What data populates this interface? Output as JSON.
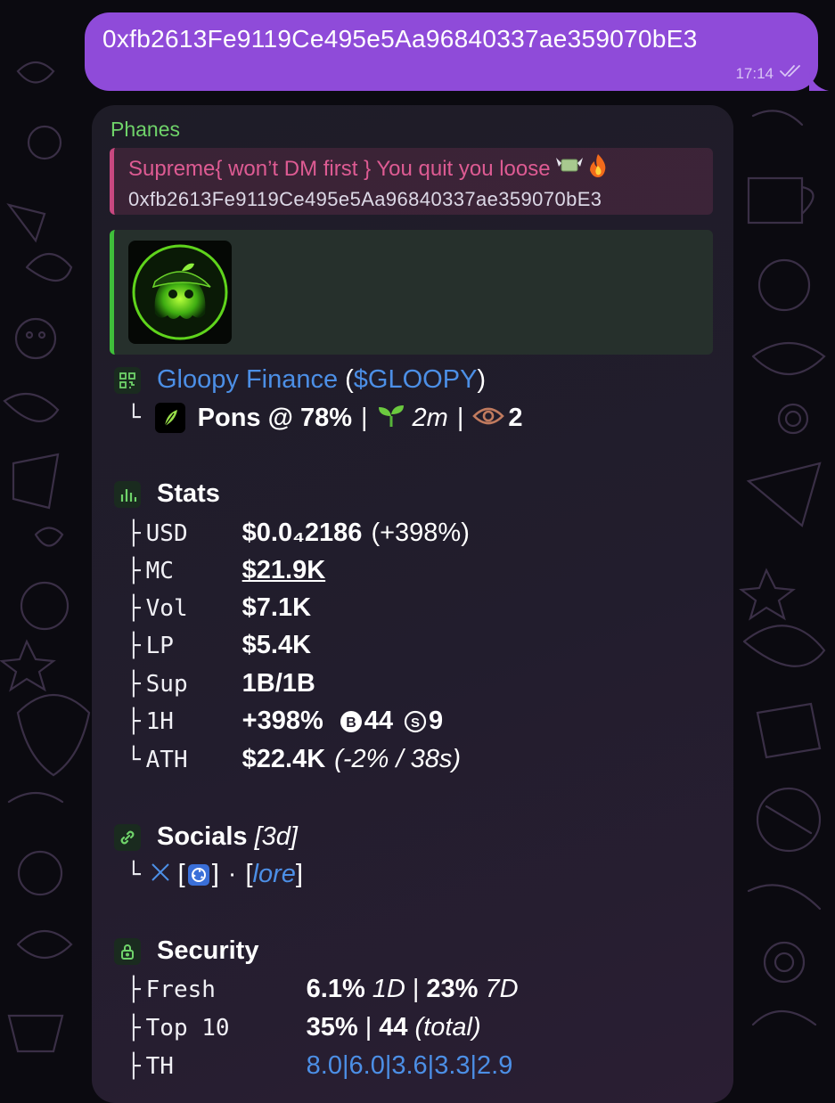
{
  "outgoing": {
    "text": "0xfb2613Fe9119Ce495e5Aa96840337ae359070bE3",
    "time": "17:14"
  },
  "incoming": {
    "sender": "Phanes",
    "reply": {
      "title": "Supreme{ won’t DM first } You quit you loose",
      "text": "0xfb2613Fe9119Ce495e5Aa96840337ae359070bE3"
    },
    "token": {
      "name": "Gloopy Finance",
      "ticker": "$GLOOPY",
      "open_paren": "(",
      "close_paren": ")",
      "sub_prefix": "└",
      "platform": "Pons @ 78%",
      "sep": "|",
      "age": "2m",
      "views": "2"
    },
    "stats": {
      "title": "Stats",
      "rows": {
        "usd": {
          "tree": "├",
          "label": "USD",
          "value": "$0.0₄2186",
          "extra": "(+398%)"
        },
        "mc": {
          "tree": "├",
          "label": "MC",
          "value": "$21.9K"
        },
        "vol": {
          "tree": "├",
          "label": "Vol",
          "value": "$7.1K"
        },
        "lp": {
          "tree": "├",
          "label": "LP",
          "value": "$5.4K"
        },
        "sup": {
          "tree": "├",
          "label": "Sup",
          "value": "1B/1B"
        },
        "h1": {
          "tree": "├",
          "label": "1H",
          "value": "+398%",
          "buys": "44",
          "sells": "9"
        },
        "ath": {
          "tree": "└",
          "label": "ATH",
          "value": "$22.4K",
          "extra": "(-2% / 38s)"
        }
      }
    },
    "socials": {
      "title": "Socials",
      "age": "[3d]",
      "tree": "└",
      "x_open": "[",
      "x_close": "]",
      "dot": "·",
      "lore_open": "[",
      "lore": "lore",
      "lore_close": "]"
    },
    "security": {
      "title": "Security",
      "fresh": {
        "tree": "├",
        "label": "Fresh",
        "v1": "6.1%",
        "p1": "1D",
        "sep": "|",
        "v2": "23%",
        "p2": "7D"
      },
      "top10": {
        "tree": "├",
        "label": "Top 10",
        "v1": "35%",
        "sep": "|",
        "v2": "44",
        "p2": "(total)"
      },
      "th": {
        "tree": "├",
        "label": "TH",
        "values": "8.0|6.0|3.6|3.3|2.9"
      }
    }
  }
}
